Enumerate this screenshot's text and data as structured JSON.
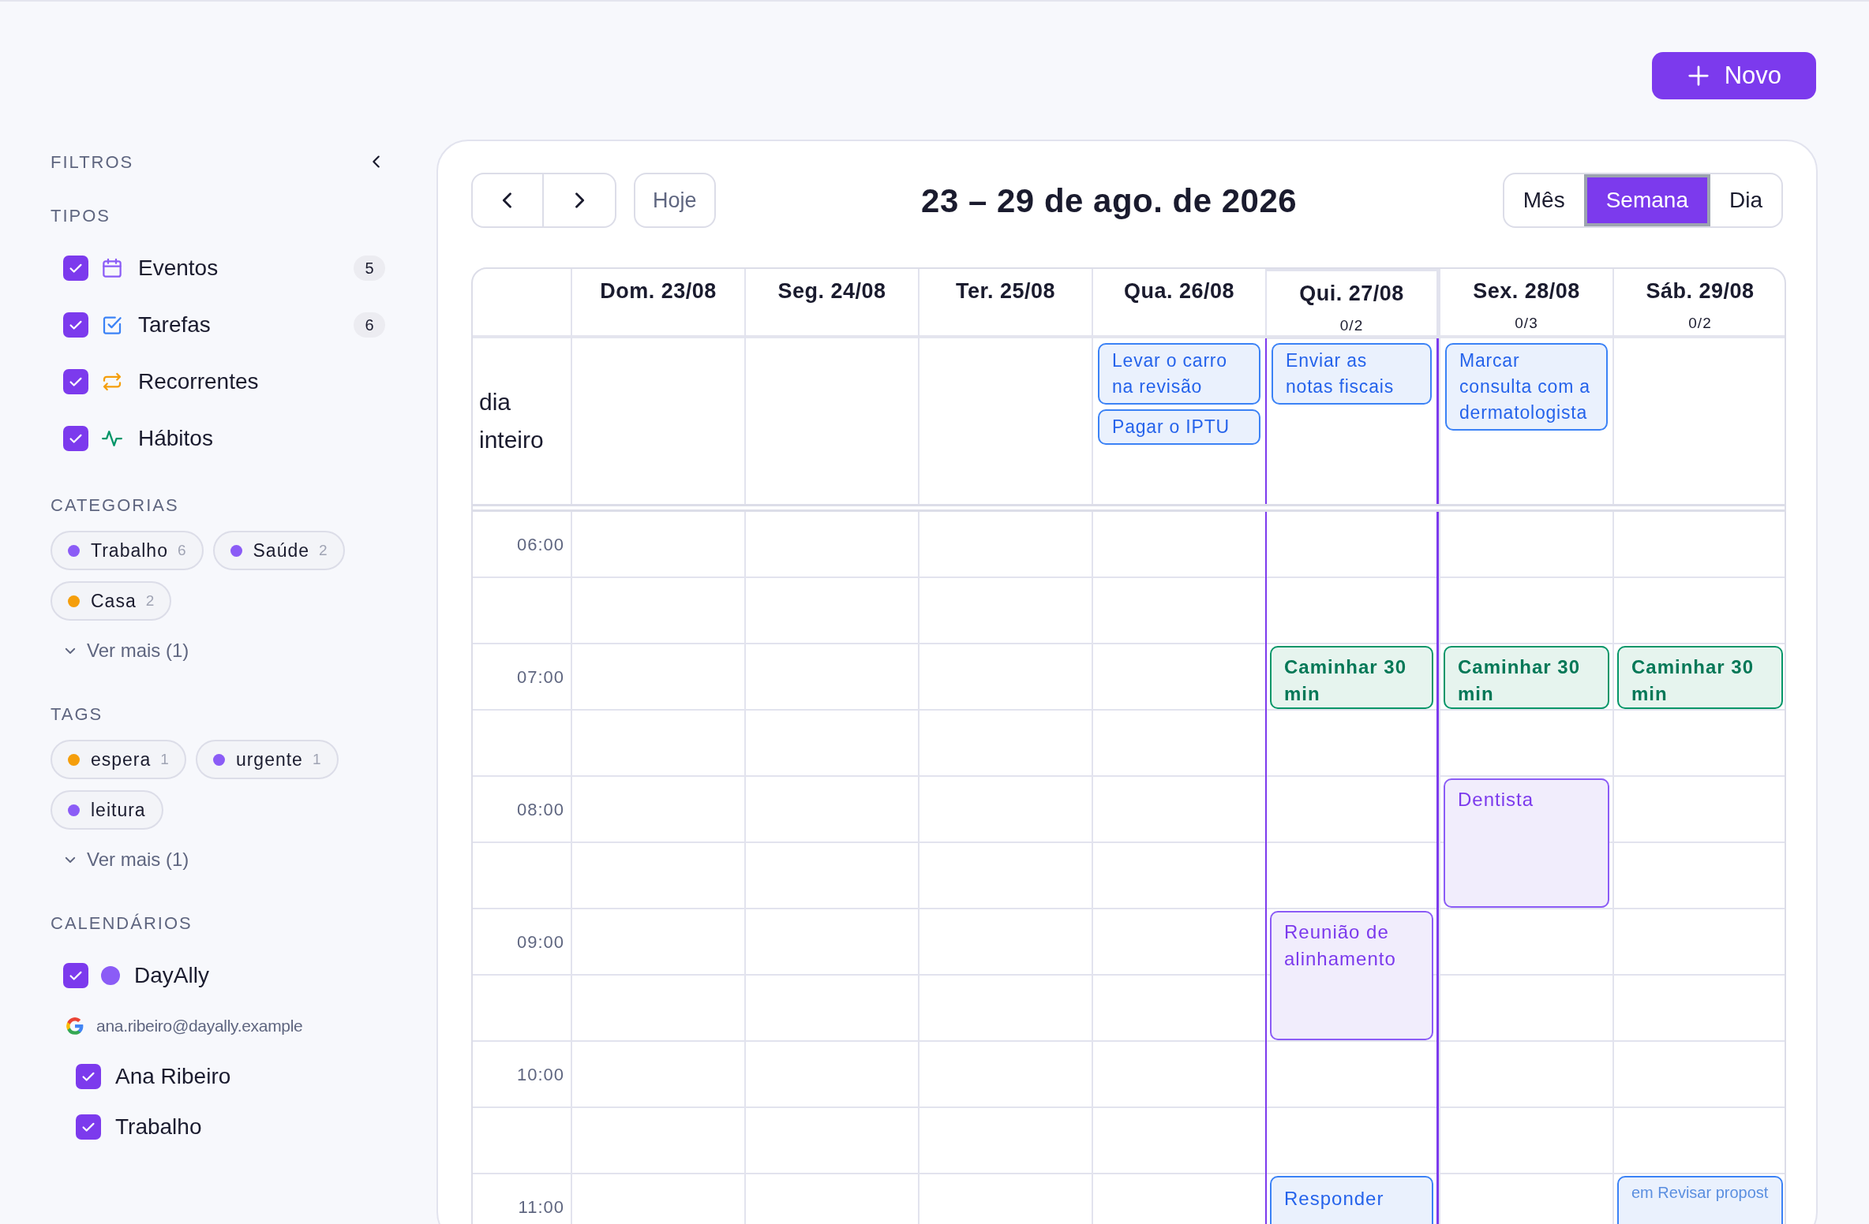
{
  "new_button": {
    "label": "Novo"
  },
  "filters": {
    "title": "FILTROS"
  },
  "types": {
    "title": "TIPOS",
    "items": [
      {
        "kind": "event",
        "label": "Eventos",
        "checked": true,
        "count": "5"
      },
      {
        "kind": "task",
        "label": "Tarefas",
        "checked": true,
        "count": "6"
      },
      {
        "kind": "recurring",
        "label": "Recorrentes",
        "checked": true
      },
      {
        "kind": "habit",
        "label": "Hábitos",
        "checked": true
      }
    ]
  },
  "categories": {
    "title": "CATEGORIAS",
    "chips": [
      {
        "label": "Trabalho",
        "count": "6",
        "color": "#8b5cf6"
      },
      {
        "label": "Saúde",
        "count": "2",
        "color": "#8b5cf6"
      },
      {
        "label": "Casa",
        "count": "2",
        "color": "#f59e0b"
      }
    ],
    "more": "Ver mais (1)"
  },
  "tags": {
    "title": "TAGS",
    "chips": [
      {
        "label": "espera",
        "count": "1",
        "color": "#f59e0b"
      },
      {
        "label": "urgente",
        "count": "1",
        "color": "#8b5cf6"
      },
      {
        "label": "leitura",
        "color": "#8b5cf6"
      }
    ],
    "more": "Ver mais (1)"
  },
  "calendars": {
    "title": "CALENDÁRIOS",
    "items": [
      {
        "label": "DayAlly",
        "checked": true,
        "color": "#8b5cf6"
      }
    ],
    "accounts": [
      {
        "email": "ana.ribeiro@dayally.example",
        "calendars": [
          {
            "label": "Ana Ribeiro",
            "checked": true
          },
          {
            "label": "Trabalho",
            "checked": true
          }
        ]
      }
    ]
  },
  "toolbar": {
    "today": "Hoje",
    "title": "23 – 29 de ago. de 2026",
    "views": [
      {
        "label": "Mês",
        "selected": false
      },
      {
        "label": "Semana",
        "selected": true
      },
      {
        "label": "Dia",
        "selected": false
      }
    ]
  },
  "all_day_label": "dia inteiro",
  "hours": [
    {
      "label": "06:00",
      "cells": [
        {
          "kind": "empty"
        },
        {
          "kind": "empty"
        },
        {
          "kind": "empty"
        },
        {
          "kind": "empty"
        },
        {
          "kind": "empty"
        },
        {
          "kind": "empty"
        },
        {
          "kind": "empty"
        }
      ]
    },
    {
      "label": "07:00",
      "cells": [
        {
          "kind": "empty"
        },
        {
          "kind": "empty"
        },
        {
          "kind": "empty"
        },
        {
          "kind": "empty"
        },
        {
          "kind": "habit",
          "title": "Caminhar 30 min"
        },
        {
          "kind": "habit",
          "title": "Caminhar 30 min"
        },
        {
          "kind": "habit",
          "title": "Caminhar 30 min"
        }
      ]
    },
    {
      "label": "08:00",
      "cells": [
        {
          "kind": "empty"
        },
        {
          "kind": "empty"
        },
        {
          "kind": "empty"
        },
        {
          "kind": "empty"
        },
        {
          "kind": "empty"
        },
        {
          "kind": "event",
          "title": "Dentista"
        },
        {
          "kind": "empty"
        }
      ]
    },
    {
      "label": "09:00",
      "cells": [
        {
          "kind": "empty"
        },
        {
          "kind": "empty"
        },
        {
          "kind": "empty"
        },
        {
          "kind": "empty"
        },
        {
          "kind": "event",
          "title": "Reunião de alinhamento"
        },
        {
          "kind": "empty"
        },
        {
          "kind": "empty"
        }
      ]
    },
    {
      "label": "10:00",
      "cells": [
        {
          "kind": "empty"
        },
        {
          "kind": "empty"
        },
        {
          "kind": "empty"
        },
        {
          "kind": "empty"
        },
        {
          "kind": "empty"
        },
        {
          "kind": "empty"
        },
        {
          "kind": "empty"
        }
      ]
    },
    {
      "label": "11:00",
      "cells": [
        {
          "kind": "empty"
        },
        {
          "kind": "empty"
        },
        {
          "kind": "empty"
        },
        {
          "kind": "empty"
        },
        {
          "kind": "task",
          "title": "Responder"
        },
        {
          "kind": "empty"
        },
        {
          "kind": "task",
          "subtitle": "em Revisar propost"
        }
      ]
    }
  ],
  "days": [
    {
      "label": "Dom. 23/08",
      "today": false
    },
    {
      "label": "Seg. 24/08",
      "today": false
    },
    {
      "label": "Ter. 25/08",
      "today": false
    },
    {
      "label": "Qua. 26/08",
      "today": false,
      "all_day": [
        {
          "title": "Levar o carro na revisão"
        },
        {
          "title": "Pagar o IPTU"
        }
      ]
    },
    {
      "label": "Qui. 27/08",
      "today": true,
      "progress": "0/2",
      "all_day": [
        {
          "title": "Enviar as notas fiscais"
        }
      ]
    },
    {
      "label": "Sex. 28/08",
      "today": false,
      "progress": "0/3",
      "all_day": [
        {
          "title": "Marcar consulta com a dermatologista"
        }
      ]
    },
    {
      "label": "Sáb. 29/08",
      "today": false,
      "progress": "0/2"
    }
  ]
}
